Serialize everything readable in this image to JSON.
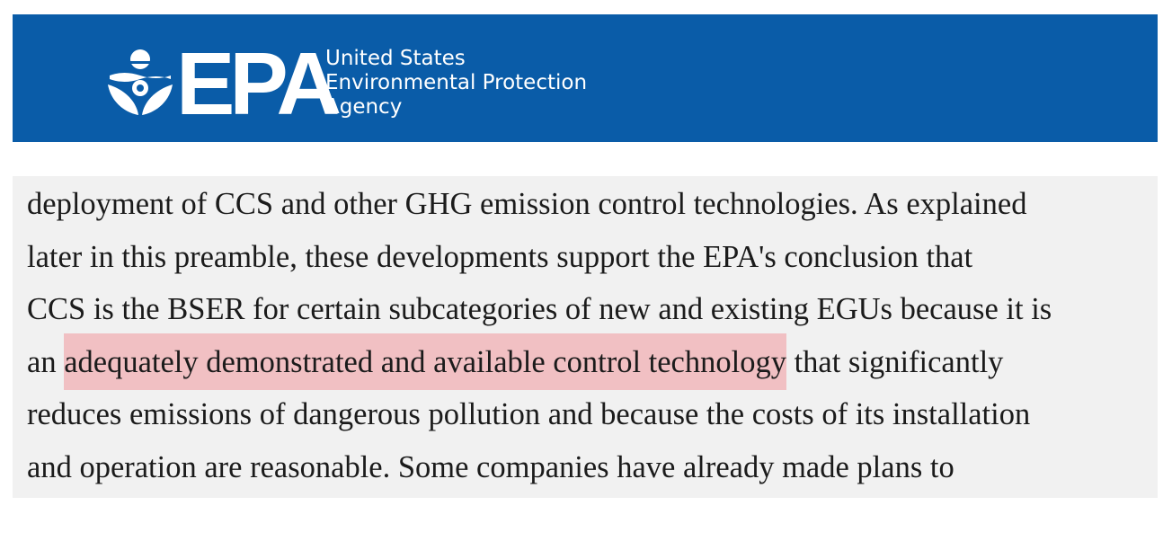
{
  "header": {
    "logo_acronym": "EPA",
    "logo_name_lines": [
      "United States",
      "Environmental Protection",
      "Agency"
    ],
    "background_color": "#0a5ca8"
  },
  "excerpt": {
    "lines": [
      "deployment of CCS and other GHG emission control technologies. As explained",
      "later in this preamble, these developments support the EPA's conclusion that",
      "CCS is the BSER for certain subcategories of new and existing EGUs because it is"
    ],
    "line4_before": "an ",
    "line4_highlight": "adequately demonstrated and available control technology",
    "line4_after": " that significantly",
    "lines_after": [
      "reduces emissions of dangerous pollution and because the costs of its installation",
      "and operation are reasonable. Some companies have already made plans to"
    ],
    "highlight_color": "#f1c0c3",
    "background_color": "#f1f1f1"
  }
}
